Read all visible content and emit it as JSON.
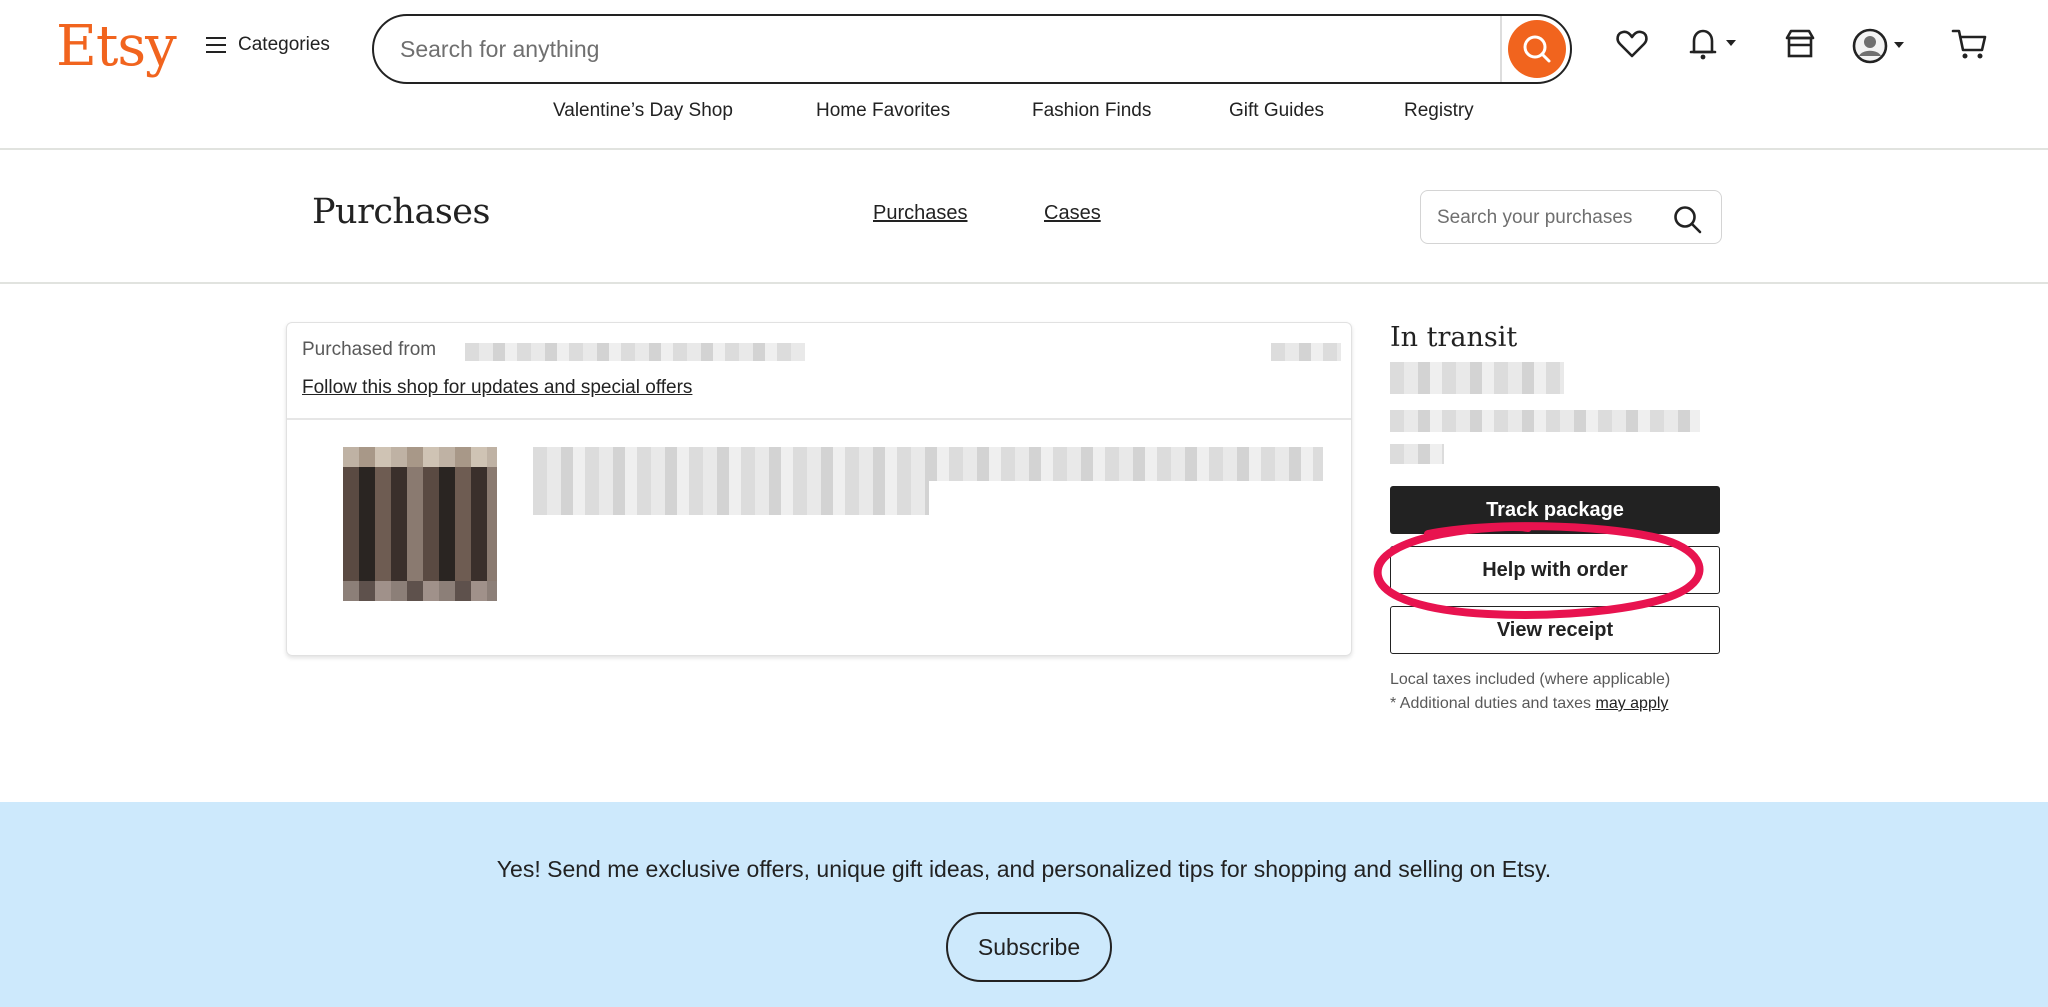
{
  "header": {
    "logo": "Etsy",
    "categories_label": "Categories",
    "search_placeholder": "Search for anything",
    "icons": [
      "heart-icon",
      "bell-icon",
      "shop-icon",
      "account-icon",
      "cart-icon"
    ],
    "nav_links": [
      "Valentine’s Day Shop",
      "Home Favorites",
      "Fashion Finds",
      "Gift Guides",
      "Registry"
    ]
  },
  "subheader": {
    "title": "Purchases",
    "tabs": [
      "Purchases",
      "Cases"
    ],
    "search_placeholder": "Search your purchases"
  },
  "order": {
    "purchased_from_label": "Purchased from",
    "follow_link": "Follow this shop for updates and special offers"
  },
  "status": {
    "title": "In transit",
    "buttons": {
      "track": "Track package",
      "help": "Help with order",
      "receipt": "View receipt"
    },
    "fine_print_1": "Local taxes included (where applicable)",
    "fine_print_2": "* Additional duties and taxes",
    "fine_print_link": "may apply"
  },
  "footer": {
    "subscribe_text": "Yes! Send me exclusive offers, unique gift ideas, and personalized tips for shopping and selling on Etsy.",
    "subscribe_button": "Subscribe"
  },
  "colors": {
    "brand": "#f1641e",
    "annotation": "#e8134f",
    "footer_bg": "#cde9fc"
  }
}
